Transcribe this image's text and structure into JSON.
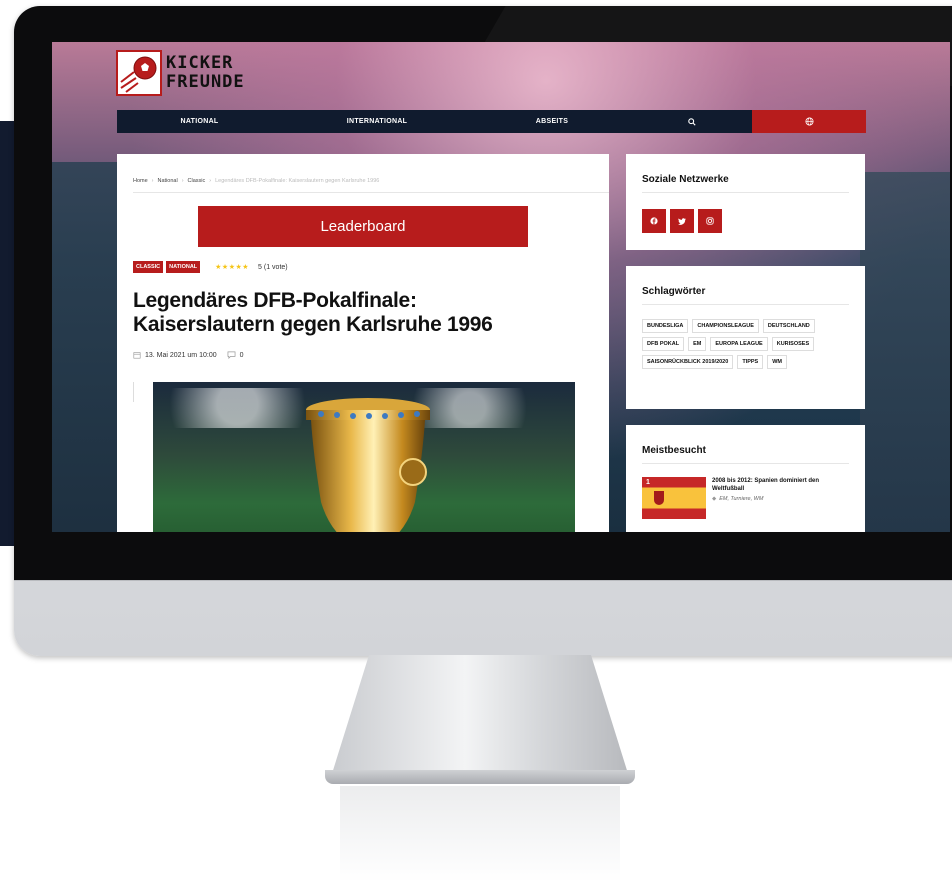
{
  "logo": {
    "line1": "KICKER",
    "line2": "FREUNDE"
  },
  "nav": {
    "items": [
      {
        "label": "NATIONAL"
      },
      {
        "label": "INTERNATIONAL"
      },
      {
        "label": "ABSEITS"
      }
    ],
    "search_icon": "search-icon",
    "globe_icon": "globe-icon"
  },
  "breadcrumb": {
    "home": "Home",
    "national": "National",
    "classic": "Classic",
    "current": "Legendäres DFB-Pokalfinale: Kaiserslautern gegen Karlsruhe 1996"
  },
  "ad": {
    "label": "Leaderboard"
  },
  "article": {
    "categories": [
      "CLASSIC",
      "NATIONAL"
    ],
    "stars": "★★★★★",
    "rating_text": "5 (1 vote)",
    "title": "Legendäres DFB-Pokalfinale: Kaiserslautern gegen Karlsruhe 1996",
    "date": "13. Mai 2021 um 10:00",
    "comments": "0"
  },
  "sidebar": {
    "social_title": "Soziale Netzwerke",
    "social_icons": [
      "facebook-icon",
      "twitter-icon",
      "instagram-icon"
    ],
    "tags_title": "Schlagwörter",
    "tags": [
      "BUNDESLIGA",
      "CHAMPIONSLEAGUE",
      "DEUTSCHLAND",
      "DFB POKAL",
      "EM",
      "EUROPA LEAGUE",
      "KURISOSES",
      "SAISONRÜCKBLICK 2019/2020",
      "TIPPS",
      "WM"
    ],
    "most_title": "Meistbesucht",
    "most_item": {
      "rank": "1",
      "title": "2008 bis 2012: Spanien dominiert den Weltfußball",
      "tags": "EM, Turniere, WM"
    }
  },
  "colors": {
    "accent": "#b71c1c",
    "nav_bg": "#101b2e",
    "star": "#f5c518"
  }
}
